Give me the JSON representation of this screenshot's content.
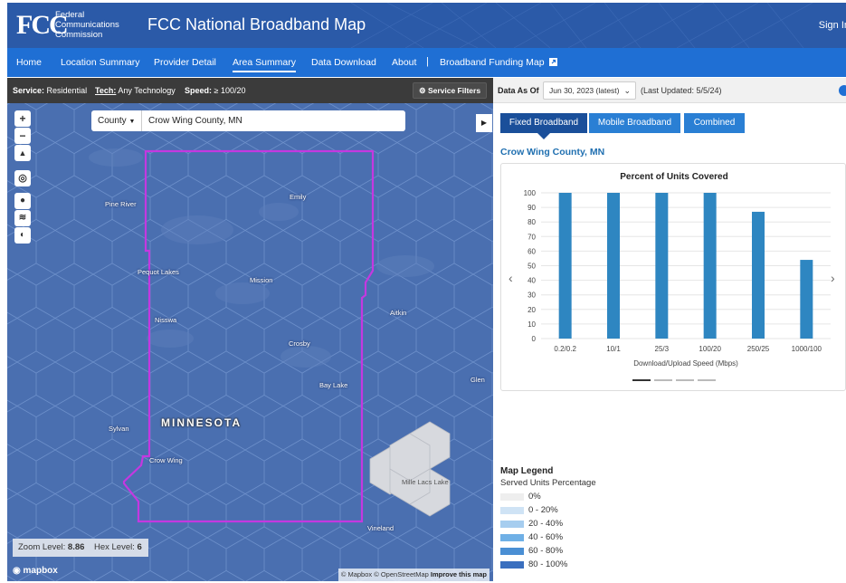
{
  "header": {
    "logo_mark": "FCC",
    "logo_lines": [
      "Federal",
      "Communications",
      "Commission"
    ],
    "title": "FCC National Broadband Map",
    "sign_in": "Sign In"
  },
  "nav": {
    "items": [
      "Home",
      "Location Summary",
      "Provider Detail",
      "Area Summary",
      "Data Download",
      "About"
    ],
    "active": "Area Summary",
    "separator": "|",
    "funding_link": "Broadband Funding Map"
  },
  "filters": {
    "service_label": "Service:",
    "service_value": "Residential",
    "tech_label": "Tech:",
    "tech_value": "Any Technology",
    "speed_label": "Speed:",
    "speed_value": "≥ 100/20",
    "button": "Service Filters"
  },
  "map": {
    "search_type": "County",
    "search_value": "Crow Wing County, MN",
    "state_label": "MINNESOTA",
    "places": [
      "Pine River",
      "Emily",
      "Pequot Lakes",
      "Mission",
      "Nisswa",
      "Aitkin",
      "Crosby",
      "Bay Lake",
      "Glen",
      "Sylvan",
      "Crow Wing",
      "Mille Lacs Lake",
      "Vineland"
    ],
    "zoom_label": "Zoom Level:",
    "zoom_value": "8.86",
    "hex_label": "Hex Level:",
    "hex_value": "6",
    "brand": "mapbox",
    "attribution": "© Mapbox © OpenStreetMap",
    "improve": "Improve this map"
  },
  "panel": {
    "data_as_of_label": "Data As Of",
    "data_as_of_value": "Jun 30, 2023 (latest)",
    "last_updated": "(Last Updated: 5/5/24)",
    "tabs": [
      "Fixed Broadband",
      "Mobile Broadband",
      "Combined"
    ],
    "active_tab": "Fixed Broadband",
    "area_title": "Crow Wing County, MN"
  },
  "chart_data": {
    "type": "bar",
    "title": "Percent of Units Covered",
    "categories": [
      "0.2/0.2",
      "10/1",
      "25/3",
      "100/20",
      "250/25",
      "1000/100"
    ],
    "values": [
      100,
      100,
      100,
      100,
      87,
      54
    ],
    "xlabel": "Download/Upload Speed (Mbps)",
    "ylabel": "",
    "ylim": [
      0,
      100
    ],
    "yticks": [
      0,
      10,
      20,
      30,
      40,
      50,
      60,
      70,
      80,
      90,
      100
    ],
    "grid": true,
    "bar_color": "#2e86c1"
  },
  "legend": {
    "title": "Map Legend",
    "subtitle": "Served Units Percentage",
    "items": [
      {
        "label": "0%",
        "color": "#eeeeee"
      },
      {
        "label": "0 - 20%",
        "color": "#cfe3f5"
      },
      {
        "label": "20 - 40%",
        "color": "#a6cdef"
      },
      {
        "label": "40 - 60%",
        "color": "#6fb0e6"
      },
      {
        "label": "60 - 80%",
        "color": "#4a8fd4"
      },
      {
        "label": "80 - 100%",
        "color": "#3a6fbf"
      }
    ]
  }
}
